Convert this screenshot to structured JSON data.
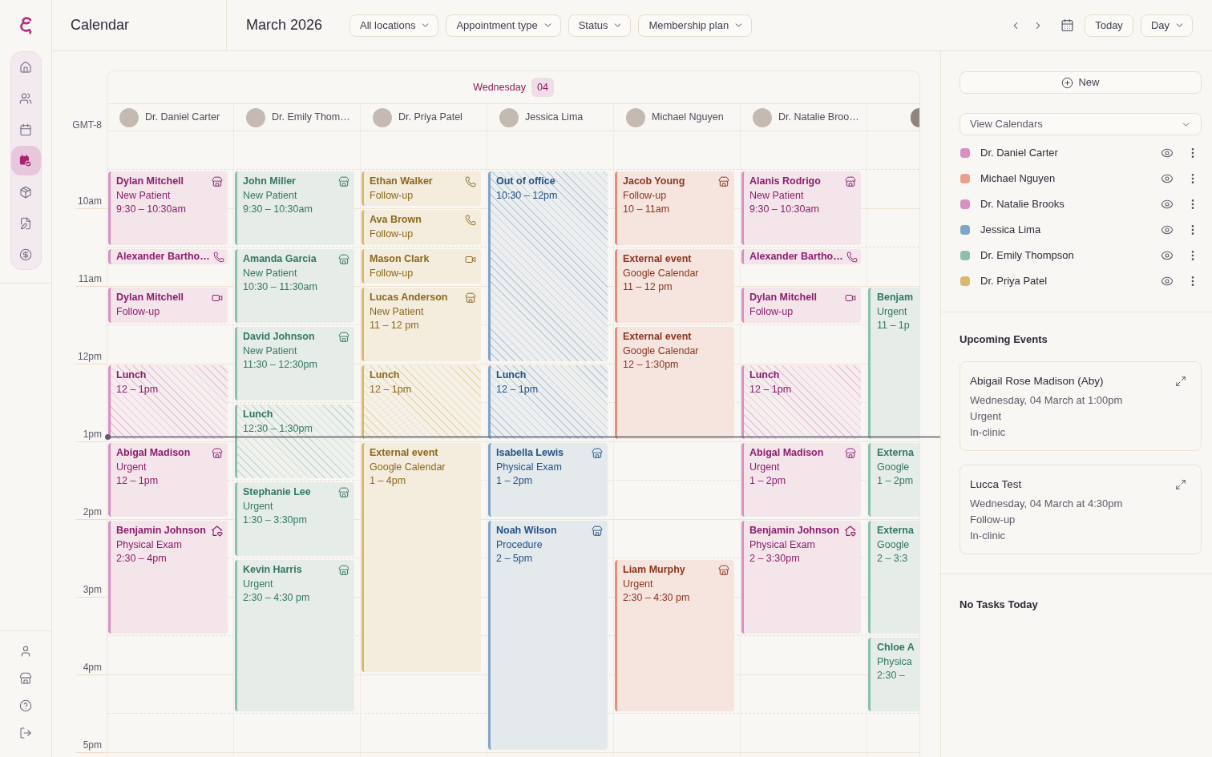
{
  "sidebar": {
    "nav": [
      {
        "selected": false
      },
      {
        "selected": false
      },
      {
        "selected": false
      },
      {
        "selected": true
      },
      {
        "selected": false
      },
      {
        "selected": false
      },
      {
        "selected": false
      }
    ]
  },
  "top_bar": {
    "title": "Calendar",
    "period": "March 2026",
    "filters": [
      "All locations",
      "Appointment type",
      "Status",
      "Membership plan"
    ],
    "today_button": "Today",
    "view_select": "Day"
  },
  "calendar": {
    "day_name": "Wednesday",
    "day_number": "04",
    "timezone": "GMT-8",
    "hours": [
      "10am",
      "11am",
      "12pm",
      "1pm",
      "2pm",
      "3pm",
      "4pm",
      "5pm"
    ],
    "columns": [
      {
        "name": "Dr. Daniel Carter",
        "color": "#d98fc4",
        "events": [
          {
            "kind": "clinic",
            "title": "Dylan Mitchell",
            "lines": [
              "New Patient",
              "9:30 – 10:30am"
            ]
          },
          {
            "kind": "phone",
            "title": "Alexander Bartho…"
          },
          {
            "kind": "video",
            "title": "Dylan Mitchell",
            "lines": [
              "Follow-up"
            ]
          },
          {
            "kind": "blocked",
            "title": "Lunch",
            "lines": [
              "12 – 1pm"
            ]
          },
          {
            "kind": "clinic",
            "title": "Abigal Madison",
            "lines": [
              "Urgent",
              "12 – 1pm"
            ]
          },
          {
            "kind": "home",
            "title": "Benjamin Johnson",
            "lines": [
              "Physical Exam",
              "2:30 – 4pm"
            ]
          }
        ]
      },
      {
        "name": "Dr. Emily Thom…",
        "color": "#8bbfb0",
        "events": [
          {
            "kind": "clinic",
            "title": "John Miller",
            "lines": [
              "New Patient",
              "9:30 – 10:30am"
            ]
          },
          {
            "kind": "clinic",
            "title": "Amanda Garcia",
            "lines": [
              "New Patient",
              "10:30 – 11:30am"
            ]
          },
          {
            "kind": "clinic",
            "title": "David Johnson",
            "lines": [
              "New Patient",
              "11:30 – 12:30pm"
            ]
          },
          {
            "kind": "blocked",
            "title": "Lunch",
            "lines": [
              "12:30 – 1:30pm"
            ]
          },
          {
            "kind": "clinic",
            "title": "Stephanie Lee",
            "lines": [
              "Urgent",
              "1:30 – 3:30pm"
            ]
          },
          {
            "kind": "clinic",
            "title": "Kevin Harris",
            "lines": [
              "Urgent",
              "2:30 – 4:30 pm"
            ]
          }
        ]
      },
      {
        "name": "Dr. Priya Patel",
        "color": "#d9b870",
        "events": [
          {
            "kind": "phone",
            "title": "Ethan Walker",
            "lines": [
              "Follow-up"
            ]
          },
          {
            "kind": "phone",
            "title": "Ava Brown",
            "lines": [
              "Follow-up"
            ]
          },
          {
            "kind": "video",
            "title": "Mason Clark",
            "lines": [
              "Follow-up"
            ]
          },
          {
            "kind": "clinic",
            "title": "Lucas Anderson",
            "lines": [
              "New Patient",
              "11 – 12 pm"
            ]
          },
          {
            "kind": "blocked",
            "title": "Lunch",
            "lines": [
              "12 – 1pm"
            ]
          },
          {
            "kind": "plain",
            "title": "External event",
            "lines": [
              "Google Calendar",
              "1 – 4pm"
            ]
          }
        ]
      },
      {
        "name": "Jessica Lima",
        "color": "#7fa3c9",
        "events": [
          {
            "kind": "blocked",
            "title": "Out of office",
            "lines": [
              "10:30 – 12pm"
            ]
          },
          {
            "kind": "blocked",
            "title": "Lunch",
            "lines": [
              "12 – 1pm"
            ]
          },
          {
            "kind": "clinic",
            "title": "Isabella Lewis",
            "lines": [
              "Physical Exam",
              "1 – 2pm"
            ]
          },
          {
            "kind": "clinic",
            "title": "Noah Wilson",
            "lines": [
              "Procedure",
              "2 – 5pm"
            ]
          }
        ]
      },
      {
        "name": "Michael Nguyen",
        "color": "#e3907a",
        "events": [
          {
            "kind": "clinic",
            "title": "Jacob Young",
            "lines": [
              "Follow-up",
              "10 – 11am"
            ]
          },
          {
            "kind": "plain",
            "title": "External event",
            "lines": [
              "Google Calendar",
              "11 – 12 pm"
            ]
          },
          {
            "kind": "plain",
            "title": "External event",
            "lines": [
              "Google Calendar",
              "12 – 1:30pm"
            ]
          },
          {
            "kind": "clinic",
            "title": "Liam Murphy",
            "lines": [
              "Urgent",
              "2:30 – 4:30 pm"
            ]
          }
        ]
      },
      {
        "name": "Dr. Natalie Broo…",
        "color": "#d98fc4",
        "events": [
          {
            "kind": "clinic",
            "title": "Alanis Rodrigo",
            "lines": [
              "New Patient",
              "9:30 – 10:30am"
            ]
          },
          {
            "kind": "phone",
            "title": "Alexander Bartho…"
          },
          {
            "kind": "video",
            "title": "Dylan Mitchell",
            "lines": [
              "Follow-up"
            ]
          },
          {
            "kind": "blocked",
            "title": "Lunch",
            "lines": [
              "12 – 1pm"
            ]
          },
          {
            "kind": "clinic",
            "title": "Abigal Madison",
            "lines": [
              "Urgent",
              "1 – 2pm"
            ]
          },
          {
            "kind": "home",
            "title": "Benjamin Johnson",
            "lines": [
              "Physical Exam",
              "2 – 3:30pm"
            ]
          }
        ]
      },
      {
        "color": "#8bbfb0",
        "events": [
          {
            "kind": "plain",
            "title": "Benjam",
            "lines": [
              "Urgent",
              "11 – 1p"
            ]
          },
          {
            "kind": "plain",
            "title": "Externa",
            "lines": [
              "Google",
              "1 – 2pm"
            ]
          },
          {
            "kind": "plain",
            "title": "Externa",
            "lines": [
              "Google",
              "2 – 3:3"
            ]
          },
          {
            "kind": "plain",
            "title": "Chloe A",
            "lines": [
              "Physica",
              "2:30 –"
            ]
          }
        ]
      }
    ]
  },
  "right_panel": {
    "new_button": "New",
    "calendars_select": "View Calendars",
    "calendars": [
      {
        "name": "Dr. Daniel Carter",
        "color": "#d98fc4",
        "visible": true
      },
      {
        "name": "Michael Nguyen",
        "color": "#eba08c",
        "visible": true
      },
      {
        "name": "Dr. Natalie Brooks",
        "color": "#d98fc4",
        "visible": true
      },
      {
        "name": "Jessica Lima",
        "color": "#7fa3c9",
        "visible": true
      },
      {
        "name": "Dr. Emily Thompson",
        "color": "#8bbfb0",
        "visible": true
      },
      {
        "name": "Dr. Priya Patel",
        "color": "#d9b870",
        "visible": true
      }
    ],
    "upcoming_title": "Upcoming Events",
    "upcoming": [
      {
        "name": "Abigail Rose Madison (Aby)",
        "when": "Wednesday, 04 March at 1:00pm",
        "type": "Urgent",
        "location": "In-clinic"
      },
      {
        "name": "Lucca Test",
        "when": "Wednesday, 04 March at 4:30pm",
        "type": "Follow-up",
        "location": "In-clinic"
      }
    ],
    "tasks": "No Tasks Today"
  }
}
